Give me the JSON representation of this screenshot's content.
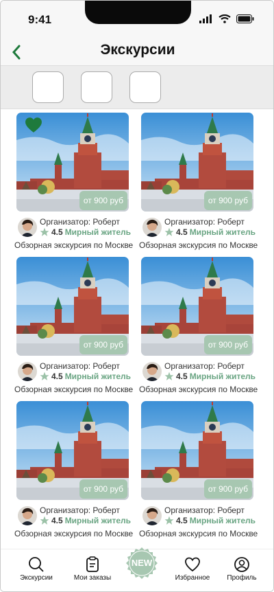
{
  "status": {
    "time": "9:41"
  },
  "header": {
    "title": "Экскурсии"
  },
  "cards": [
    {
      "price": "от 900 руб",
      "organizer": "Организатор: Роберт",
      "rating": "4.5",
      "rank": "Мирный житель",
      "title": "Обзорная экскурсия по Москве",
      "favorite": true
    },
    {
      "price": "от 900 руб",
      "organizer": "Организатор: Роберт",
      "rating": "4.5",
      "rank": "Мирный житель",
      "title": "Обзорная экскурсия по Москве",
      "favorite": false
    },
    {
      "price": "от 900 руб",
      "organizer": "Организатор: Роберт",
      "rating": "4.5",
      "rank": "Мирный житель",
      "title": "Обзорная экскурсия по Москве",
      "favorite": false
    },
    {
      "price": "от 900 руб",
      "organizer": "Организатор: Роберт",
      "rating": "4.5",
      "rank": "Мирный житель",
      "title": "Обзорная экскурсия по Москве",
      "favorite": false
    },
    {
      "price": "от 900 руб",
      "organizer": "Организатор: Роберт",
      "rating": "4.5",
      "rank": "Мирный житель",
      "title": "Обзорная экскурсия по Москве",
      "favorite": false
    },
    {
      "price": "от 900 руб",
      "organizer": "Организатор: Роберт",
      "rating": "4.5",
      "rank": "Мирный житель",
      "title": "Обзорная экскурсия по Москве",
      "favorite": false
    }
  ],
  "nav": {
    "excursions": "Экскурсии",
    "orders": "Мои заказы",
    "new": "NEW",
    "favorites": "Избранное",
    "profile": "Профиль"
  },
  "colors": {
    "accent": "#1e7a3c",
    "price_badge": "#a7c7b1",
    "rank": "#6aa583",
    "new_badge": "#a7c7b1"
  }
}
